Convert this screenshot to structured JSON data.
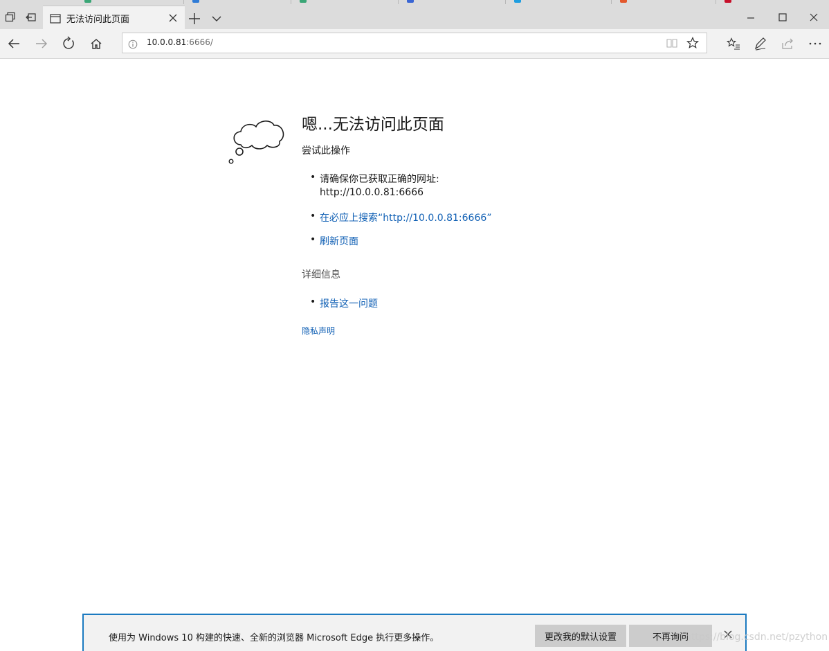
{
  "tabs": {
    "active_title": "无法访问此页面",
    "background_tab_colors": [
      "#3aa676",
      "#2f7bd6",
      "#3aa676",
      "#3a66d4",
      "#1f9ee0",
      "#e3582d",
      "#c7102a"
    ]
  },
  "address_bar": {
    "host": "10.0.0.81",
    "path": ":6666/"
  },
  "error": {
    "heading": "嗯...无法访问此页面",
    "try_label": "尝试此操作",
    "items": [
      {
        "line1": "请确保你已获取正确的网址:",
        "line2": "http://10.0.0.81:6666"
      },
      {
        "link": "在必应上搜索“http://10.0.0.81:6666”"
      },
      {
        "link": "刷新页面"
      }
    ],
    "details_label": "详细信息",
    "report_link": "报告这一问题",
    "privacy_link": "隐私声明"
  },
  "notification": {
    "message": "使用为 Windows 10 构建的快速、全新的浏览器 Microsoft Edge 执行更多操作。",
    "change_default_label": "更改我的默认设置",
    "dont_ask_label": "不再询问"
  },
  "watermark": "https://blog.csdn.net/pzython",
  "colors": {
    "link": "#0f5fb4",
    "accent_border": "#1b7ac0"
  }
}
